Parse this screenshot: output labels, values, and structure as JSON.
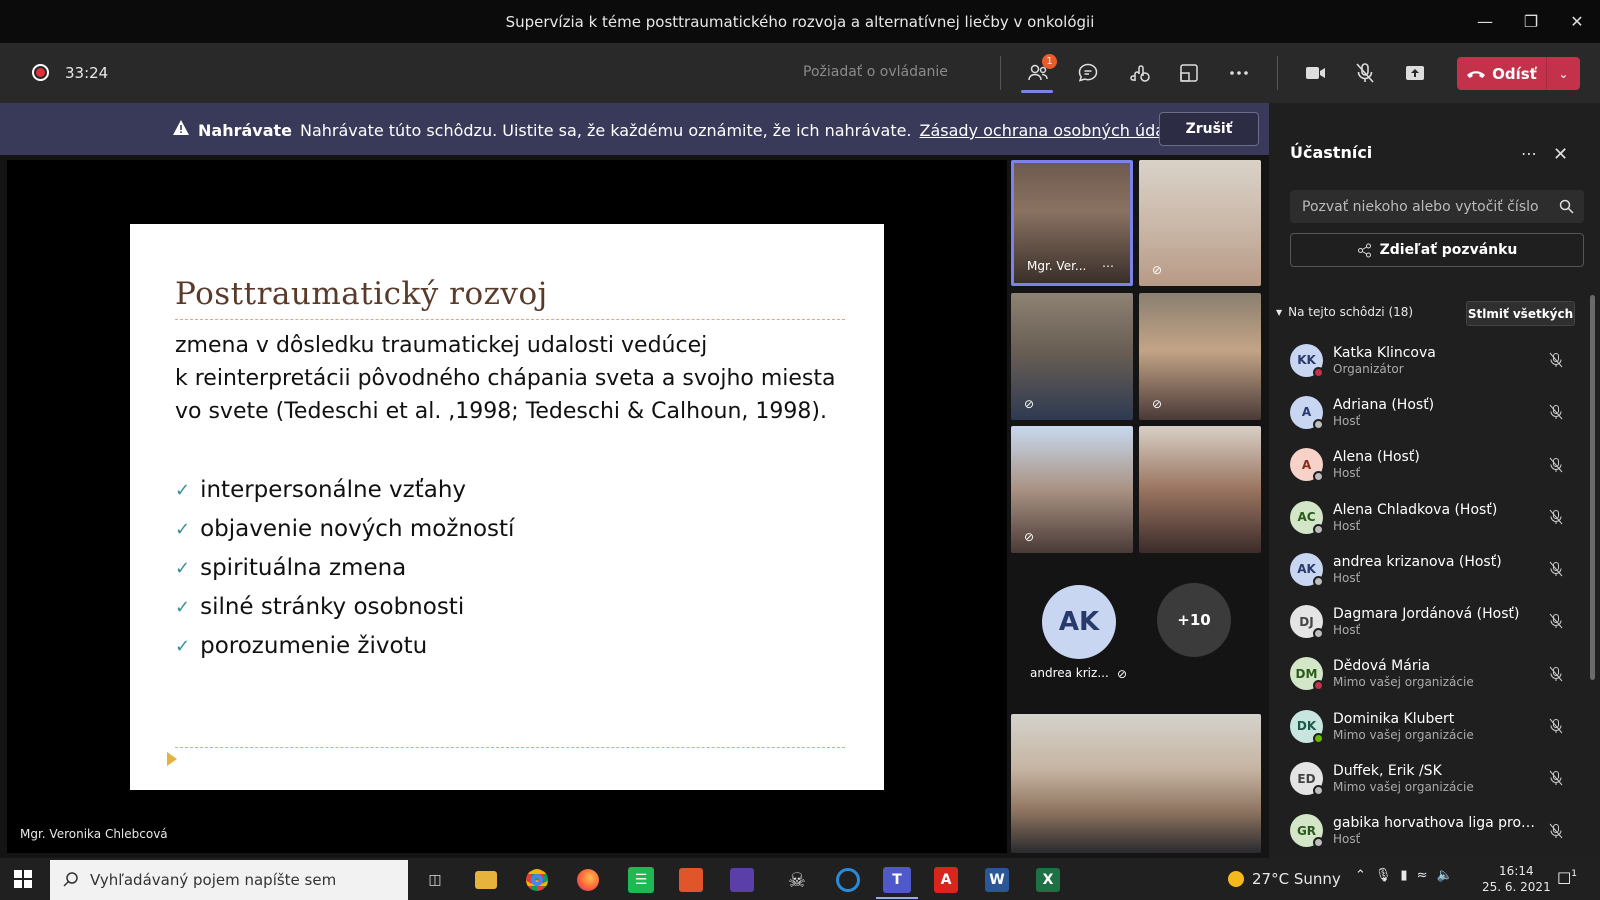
{
  "window": {
    "title": "Supervízia k téme posttraumatického rozvoja a alternatívnej liečby v onkológii"
  },
  "toolbar": {
    "timer": "33:24",
    "request_control": "Požiadať o ovládanie",
    "participants_badge": "1",
    "leave_label": "Odísť"
  },
  "banner": {
    "heading": "Nahrávate",
    "message": "Nahrávate túto schôdzu. Uistite sa, že každému oznámite, že ich nahrávate.",
    "link": "Zásady ochrana osobných údajov",
    "cancel": "Zrušiť"
  },
  "slide": {
    "title": "Posttraumatický rozvoj",
    "definition": [
      "zmena v dôsledku traumatickej udalosti vedúcej",
      "k reinterpretácii pôvodného chápania sveta a svojho miesta",
      "vo svete (Tedeschi et al. ,1998; Tedeschi & Calhoun, 1998)."
    ],
    "bullets": [
      "interpersonálne vzťahy",
      "objavenie nových možností",
      "spirituálna zmena",
      "silné stránky osobnosti",
      "porozumenie životu"
    ]
  },
  "stage": {
    "presenter": "Mgr. Veronika Chlebcová",
    "tile_active_name": "Mgr. Ver...",
    "avatar_initials": "AK",
    "avatar_name": "andrea kriz...",
    "more_count": "+10"
  },
  "panel": {
    "title": "Účastníci",
    "invite_placeholder": "Pozvať niekoho alebo vytočiť číslo",
    "share_invite": "Zdieľať pozvánku",
    "section": "Na tejto schôdzi (18)",
    "mute_all": "Stlmiť všetkých",
    "participants": [
      {
        "initials": "KK",
        "name": "Katka Klincova",
        "role": "Organizátor",
        "bg": "#c8d6f2",
        "fg": "#273a6b",
        "status": "#c4314b"
      },
      {
        "initials": "A",
        "name": "Adriana (Hosť)",
        "role": "Hosť",
        "bg": "#c8d6f2",
        "fg": "#273a6b",
        "status": "#bdbdbd"
      },
      {
        "initials": "A",
        "name": "Alena (Hosť)",
        "role": "Hosť",
        "bg": "#f6d2c8",
        "fg": "#8a2a1a",
        "status": "#bdbdbd"
      },
      {
        "initials": "AC",
        "name": "Alena Chladkova (Hosť)",
        "role": "Hosť",
        "bg": "#d3e6c8",
        "fg": "#2a5a1a",
        "status": "#bdbdbd"
      },
      {
        "initials": "AK",
        "name": "andrea krizanova (Hosť)",
        "role": "Hosť",
        "bg": "#c8d6f2",
        "fg": "#273a6b",
        "status": "#bdbdbd"
      },
      {
        "initials": "DJ",
        "name": "Dagmara Jordánová (Hosť)",
        "role": "Hosť",
        "bg": "#e4e4e4",
        "fg": "#444444",
        "status": "#bdbdbd"
      },
      {
        "initials": "DM",
        "name": "Dědová Mária",
        "role": "Mimo vašej organizácie",
        "bg": "#d3e6c8",
        "fg": "#2a5a1a",
        "status": "#c4314b"
      },
      {
        "initials": "DK",
        "name": "Dominika Klubert",
        "role": "Mimo vašej organizácie",
        "bg": "#c8e6df",
        "fg": "#1a5a4a",
        "status": "#6bb700"
      },
      {
        "initials": "ED",
        "name": "Duffek, Erik /SK",
        "role": "Mimo vašej organizácie",
        "bg": "#e4e4e4",
        "fg": "#444444",
        "status": "#bdbdbd"
      },
      {
        "initials": "GR",
        "name": "gabika horvathova liga proti r...",
        "role": "Hosť",
        "bg": "#d3e6c8",
        "fg": "#2a5a1a",
        "status": "#bdbdbd"
      }
    ]
  },
  "taskbar": {
    "search_placeholder": "Vyhľadávaný pojem napíšte sem",
    "weather": "27°C  Sunny",
    "time": "16:14",
    "date": "25. 6. 2021",
    "notifications": "1"
  },
  "colors": {
    "accent": "#7b83eb",
    "leave": "#c4314b",
    "banner": "#393a59"
  }
}
